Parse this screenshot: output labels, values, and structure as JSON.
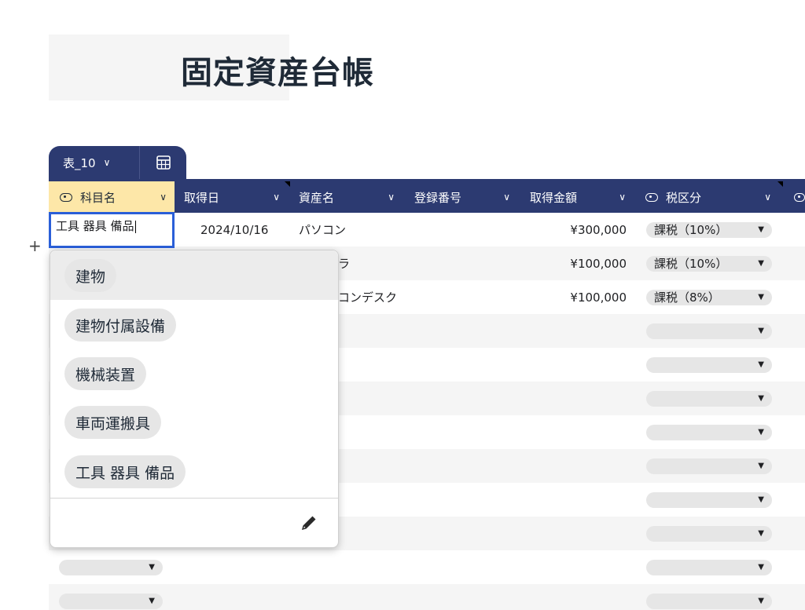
{
  "page": {
    "title": "固定資産台帳"
  },
  "table": {
    "name": "表_10"
  },
  "columns": [
    {
      "label": "科目名",
      "icon": "circle-select-icon",
      "active": true
    },
    {
      "label": "取得日"
    },
    {
      "label": "資産名"
    },
    {
      "label": "登録番号"
    },
    {
      "label": "取得金額"
    },
    {
      "label": "税区分",
      "icon": "circle-select-icon"
    }
  ],
  "editing_cell": {
    "value": "工具 器具 備品"
  },
  "rows": [
    {
      "date": "2024/10/16",
      "name": "パソコン",
      "amount": "¥300,000",
      "tax": "課税（10%）"
    },
    {
      "name": "ラ",
      "amount": "¥100,000",
      "tax": "課税（10%）"
    },
    {
      "name": "コンデスク",
      "amount": "¥100,000",
      "tax": "課税（8%）"
    }
  ],
  "dropdown": {
    "options": [
      "建物",
      "建物付属設備",
      "機械装置",
      "車両運搬具",
      "工具 器具 備品"
    ],
    "edit_icon": "pencil-icon"
  },
  "colors": {
    "header": "#2c3a71",
    "active_header": "#fde7a8",
    "selection": "#2a5fd8"
  }
}
